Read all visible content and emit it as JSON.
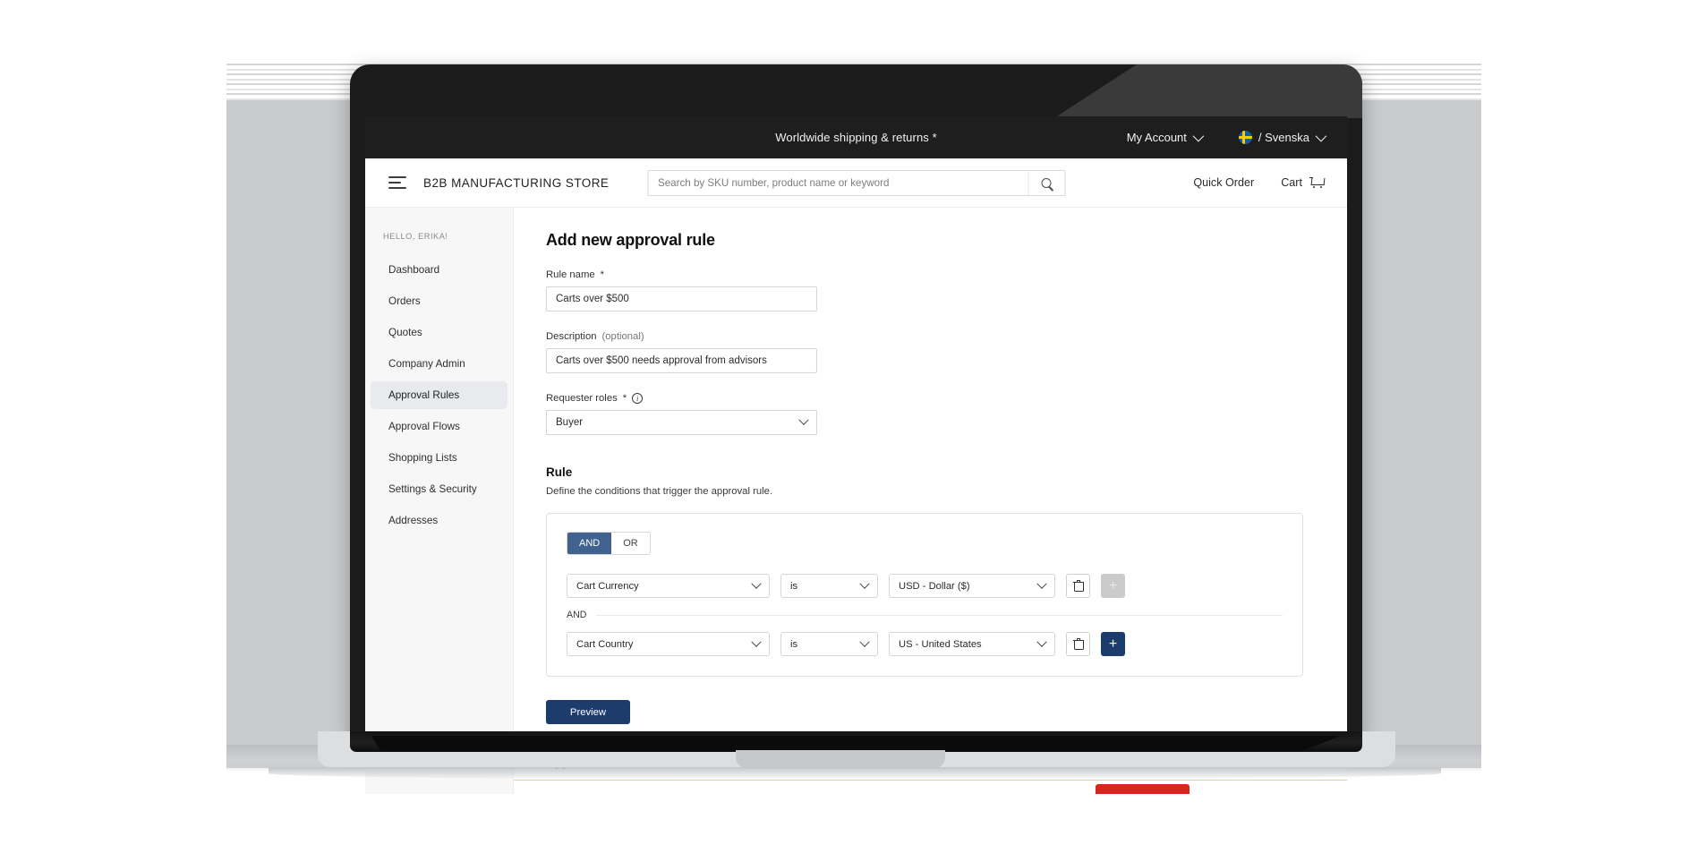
{
  "utility_bar": {
    "message": "Worldwide shipping & returns *",
    "account_label": "My Account",
    "language_label": "/ Svenska",
    "flag_icon": "swedish-flag-icon",
    "chevron_icon": "chevron-down-icon"
  },
  "masthead": {
    "menu_icon": "hamburger-menu-icon",
    "brand": "B2B MANUFACTURING STORE",
    "search": {
      "placeholder": "Search by SKU number, product name or keyword",
      "value": "",
      "icon": "search-icon"
    },
    "quick_order": "Quick Order",
    "cart_label": "Cart",
    "cart_icon": "shopping-cart-icon"
  },
  "sidebar": {
    "greeting": "HELLO, ERIKA!",
    "items": [
      {
        "label": "Dashboard",
        "active": false
      },
      {
        "label": "Orders",
        "active": false
      },
      {
        "label": "Quotes",
        "active": false
      },
      {
        "label": "Company Admin",
        "active": false
      },
      {
        "label": "Approval Rules",
        "active": true
      },
      {
        "label": "Approval Flows",
        "active": false
      },
      {
        "label": "Shopping Lists",
        "active": false
      },
      {
        "label": "Settings & Security",
        "active": false
      },
      {
        "label": "Addresses",
        "active": false
      }
    ]
  },
  "main": {
    "page_title": "Add new approval rule",
    "fields": {
      "rule_name": {
        "label": "Rule name",
        "required_mark": "*",
        "value": "Carts over $500"
      },
      "description": {
        "label": "Description",
        "optional_text": "(optional)",
        "value": "Carts over $500 needs approval from advisors"
      },
      "requester_roles": {
        "label": "Requester roles",
        "required_mark": "*",
        "info_icon": "info-icon",
        "value": "Buyer"
      }
    },
    "rule_section": {
      "title": "Rule",
      "subtitle": "Define the conditions that trigger the approval rule.",
      "logic_toggle": {
        "options": [
          "AND",
          "OR"
        ],
        "selected": "AND"
      },
      "separator_label": "AND",
      "conditions": [
        {
          "field": "Cart Currency",
          "operator": "is",
          "value": "USD - Dollar ($)",
          "delete_icon": "trash-icon",
          "add_icon": "plus-icon",
          "add_enabled": false
        },
        {
          "field": "Cart Country",
          "operator": "is",
          "value": "US - United States",
          "delete_icon": "trash-icon",
          "add_icon": "plus-icon",
          "add_enabled": true
        }
      ],
      "preview_button": "Preview"
    },
    "approvers_title": "Approvers"
  },
  "colors": {
    "accent_navy": "#1d3c6e",
    "toggle_selected": "#41618f",
    "cta_red": "#d9251d",
    "utility_bar_bg": "#1e1e1e",
    "sidebar_bg": "#f7f7f7",
    "sidebar_active_bg": "#e8eaee"
  }
}
